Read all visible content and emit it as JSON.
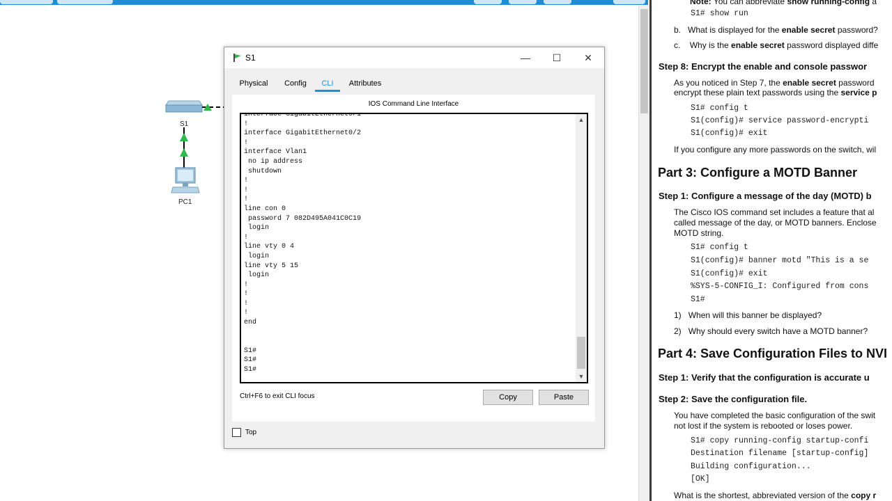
{
  "dialog": {
    "title": "S1",
    "tabs": [
      "Physical",
      "Config",
      "CLI",
      "Attributes"
    ],
    "active_tab": "CLI",
    "panel_title": "IOS Command Line Interface",
    "terminal_text": "interface GigabitEthernet0/1\n!\ninterface GigabitEthernet0/2\n!\ninterface Vlan1\n no ip address\n shutdown\n!\n!\n!\nline con 0\n password 7 082D495A041C0C19\n login\n!\nline vty 0 4\n login\nline vty 5 15\n login\n!\n!\n!\n!\nend\n\n\nS1#\nS1#\nS1#",
    "hint": "Ctrl+F6 to exit CLI focus",
    "copy_label": "Copy",
    "paste_label": "Paste",
    "top_label": "Top",
    "minimize_glyph": "—",
    "maximize_glyph": "☐",
    "close_glyph": "✕"
  },
  "workspace": {
    "switch_label": "S1",
    "pc_label": "PC1"
  },
  "doc": {
    "note_prefix": "Note:",
    "note_text": " You can abbreviate ",
    "note_bold": "show running-config",
    "note_tail": " a",
    "code_show_run": "S1# show run",
    "qb_prefix": "b.",
    "qb_text": "What is displayed for the ",
    "qb_bold": "enable secret",
    "qb_tail": " password?",
    "qc_prefix": "c.",
    "qc_text": "Why is the ",
    "qc_bold": "enable secret",
    "qc_tail": " password displayed diffe",
    "step8": "Step 8:   Encrypt the enable and console passwor",
    "step8_p1_a": "As you noticed in Step 7, the ",
    "step8_p1_b": "enable secret",
    "step8_p1_c": " password",
    "step8_p2_a": "encrypt these plain text passwords using the ",
    "step8_p2_b": "service p",
    "code_config_t": "S1# config t",
    "code_service": "S1(config)# service password-encrypti",
    "code_exit": "S1(config)# exit",
    "step8_after": "If you configure any more passwords on the switch, wil",
    "part3": "Part 3:   Configure a MOTD Banner",
    "step1_motd": "Step 1:   Configure a message of the day (MOTD) b",
    "motd_p1": "The Cisco IOS command set includes a feature that al",
    "motd_p2": "called message of the day, or MOTD banners. Enclose",
    "motd_p3": "MOTD string.",
    "code2_config_t": "S1# config t",
    "code2_banner": "S1(config)# banner motd \"This is a se",
    "code2_exit": "S1(config)# exit",
    "code2_sys": "%SYS-5-CONFIG_I: Configured from cons",
    "code2_prompt": "S1#",
    "q1_num": "1)",
    "q1_text": "When will this banner be displayed?",
    "q2_num": "2)",
    "q2_text": "Why should every switch have a MOTD banner?",
    "part4": "Part 4:   Save Configuration Files to NVI",
    "p4_step1": "Step 1:   Verify that the configuration is accurate u",
    "p4_step2": "Step 2:   Save the configuration file.",
    "p4_p1": "You have completed the basic configuration of the swit",
    "p4_p2": "not lost if the system is rebooted or loses power.",
    "code3_copy": "S1# copy running-config startup-confi",
    "code3_dest": "Destination filename [startup-config]",
    "code3_build": "Building configuration...",
    "code3_ok": "[OK]",
    "p4_last_a": "What is the shortest, abbreviated version of the ",
    "p4_last_b": "copy r"
  },
  "colors": {
    "accent": "#1e8fd6",
    "link_green": "#2fb84c",
    "switch_blue": "#7fb3d5"
  },
  "icons": [
    "packet-tracer-app-icon",
    "switch-icon",
    "pc-icon",
    "link-up-arrow-icon",
    "scroll-up-icon",
    "scroll-down-icon"
  ]
}
